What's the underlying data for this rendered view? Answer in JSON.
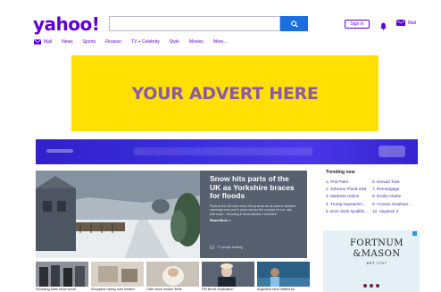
{
  "header": {
    "logo": "yahoo!",
    "search_placeholder": "",
    "sign_in": "Sign in",
    "mail": "Mail"
  },
  "nav": {
    "items": [
      "Mail",
      "News",
      "Sports",
      "Finance",
      "TV + Celebrity",
      "Style",
      "Movies",
      "More..."
    ]
  },
  "advert": {
    "text": "YOUR ADVERT HERE"
  },
  "hero": {
    "title": "Snow hits parts of the UK as Yorkshire braces for floods",
    "summary": "Parts of the UK have been hit by snow as as severe weather warnings were put in place across the country for ice, rain and snow - including in flood-stricken Yorkshire.",
    "more": "Read More »",
    "reading": "77 people reading"
  },
  "trending": {
    "title": "Trending now",
    "items": [
      "1. Priti Patel",
      "6. Donald Tusk",
      "2. Johnson Flood Visit",
      "7. Remortgage",
      "3. Mattress Online",
      "8. Emilia Clarke",
      "4. Trump Impeachm...",
      "9. Cruises Southam...",
      "5. Euro 2020 Qualifie...",
      "10. Haydock 2"
    ]
  },
  "side_ad": {
    "line1": "FORTNUM",
    "line2": "&MASON",
    "line3": "EST 1707"
  },
  "thumbs": [
    {
      "caption": "Shocking stats show worst"
    },
    {
      "caption": "Shoppers raving over heated"
    },
    {
      "caption": "Little show worker feels"
    },
    {
      "caption": "PM Brexit implication"
    },
    {
      "caption": "Argentina fans baffled by"
    }
  ],
  "colors": {
    "brand": "#5f01d1",
    "search_button": "#1a6fde",
    "advert_bg": "#ffe000",
    "advert_text": "#8a5aa5",
    "hero_panel": "#56606f",
    "banner": "#3a2ddd"
  }
}
